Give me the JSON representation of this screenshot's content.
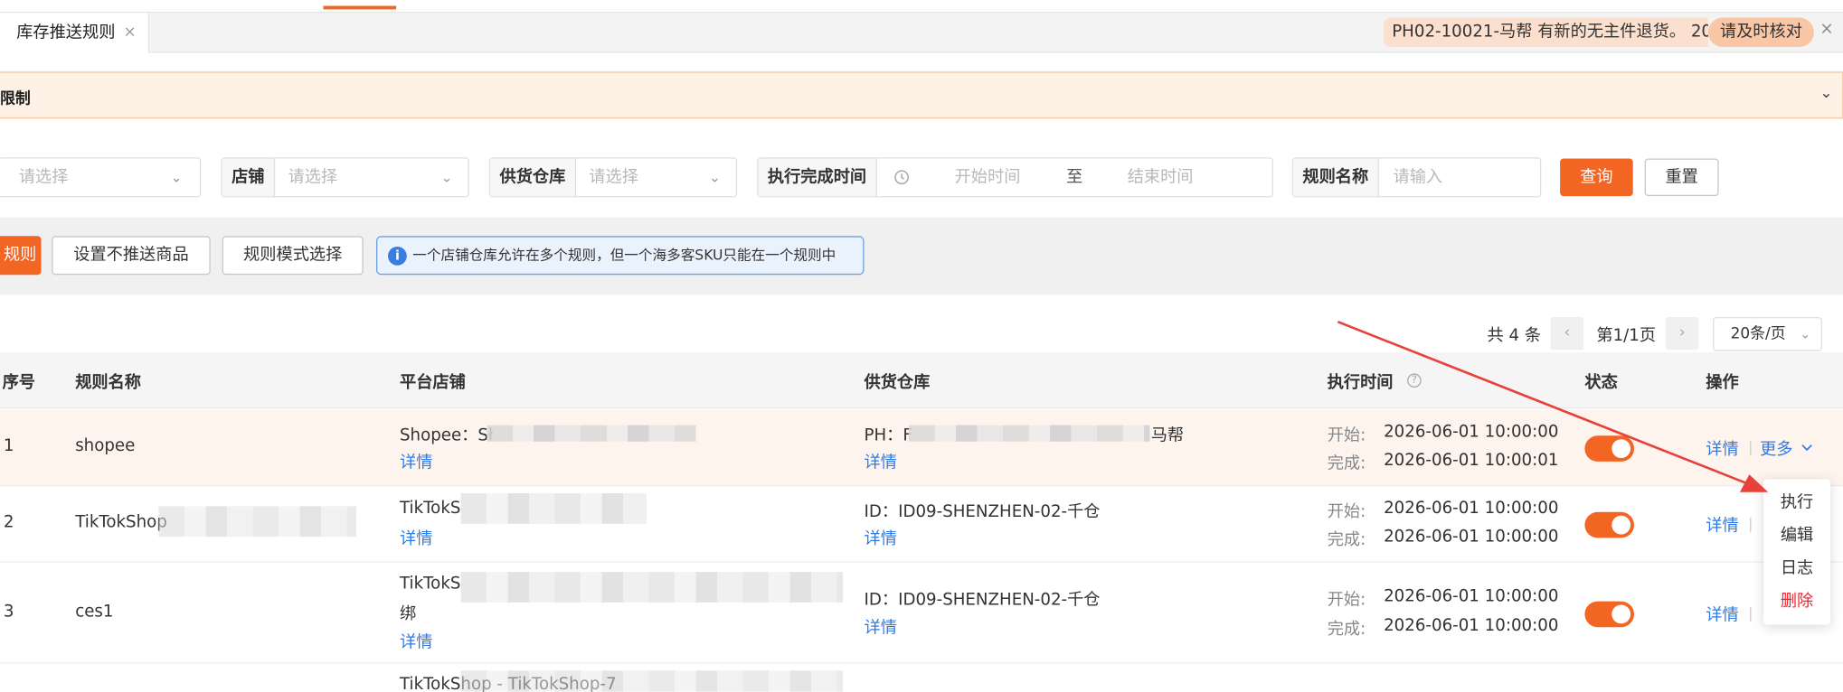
{
  "tab": {
    "title": "库存推送规则",
    "close": "×"
  },
  "notification": {
    "message": "PH02-10021-马帮 有新的无主件退货。 20",
    "action": "请及时核对",
    "close": "×"
  },
  "banner": {
    "text": "限制",
    "chevron": "⌄"
  },
  "filters": {
    "first": {
      "placeholder": "请选择",
      "chevron": "⌄"
    },
    "store": {
      "label": "店铺",
      "placeholder": "请选择",
      "chevron": "⌄"
    },
    "warehouse": {
      "label": "供货仓库",
      "placeholder": "请选择",
      "chevron": "⌄"
    },
    "time": {
      "label": "执行完成时间",
      "start": "开始时间",
      "to": "至",
      "end": "结束时间"
    },
    "rule_name": {
      "label": "规则名称",
      "placeholder": "请输入"
    },
    "query": "查询",
    "reset": "重置"
  },
  "toolbar": {
    "add_rule": "规则",
    "set_no_push": "设置不推送商品",
    "mode_select": "规则模式选择",
    "info": "一个店铺仓库允许在多个规则，但一个海多客SKU只能在一个规则中",
    "info_icon": "i"
  },
  "pager": {
    "total": "共 4 条",
    "prev": "‹",
    "page": "第1/1页",
    "next": "›",
    "size": "20条/页",
    "size_chevron": "⌄"
  },
  "columns": {
    "index": "序号",
    "name": "规则名称",
    "store": "平台店铺",
    "warehouse": "供货仓库",
    "time": "执行时间",
    "time_help": "?",
    "status": "状态",
    "ops": "操作"
  },
  "rows": [
    {
      "index": "1",
      "name": "shopee",
      "store": "Shopee：Sł",
      "store_link": "详情",
      "warehouse": "PH：F",
      "warehouse_suffix": "马帮",
      "warehouse_link": "详情",
      "start_label": "开始:",
      "start": "2026-06-01 10:00:00",
      "end_label": "完成:",
      "end": "2026-06-01 10:00:01",
      "detail": "详情",
      "more": "更多",
      "sep": "|"
    },
    {
      "index": "2",
      "name": "TikTokShop",
      "store": "TikTokS",
      "store_link": "详情",
      "warehouse": "ID：ID09-SHENZHEN-02-千仓",
      "warehouse_link": "详情",
      "start_label": "开始:",
      "start": "2026-06-01 10:00:00",
      "end_label": "完成:",
      "end": "2026-06-01 10:00:00",
      "detail": "详情",
      "sep": "|"
    },
    {
      "index": "3",
      "name": "ces1",
      "store": "TikTokS",
      "store_line2": "绑",
      "store_link": "详情",
      "warehouse": "ID：ID09-SHENZHEN-02-千仓",
      "warehouse_link": "详情",
      "start_label": "开始:",
      "start": "2026-06-01 10:00:00",
      "end_label": "完成:",
      "end": "2026-06-01 10:00:00",
      "detail": "详情",
      "sep": "|"
    },
    {
      "index": "",
      "name": "",
      "store": "TikTokShop - TikTokShop-7"
    }
  ],
  "dropdown": {
    "execute": "执行",
    "edit": "编辑",
    "log": "日志",
    "delete": "删除"
  },
  "colors": {
    "accent": "#f26522",
    "link": "#2d7be5",
    "danger": "#f5222d",
    "arrow": "#e8403a"
  }
}
